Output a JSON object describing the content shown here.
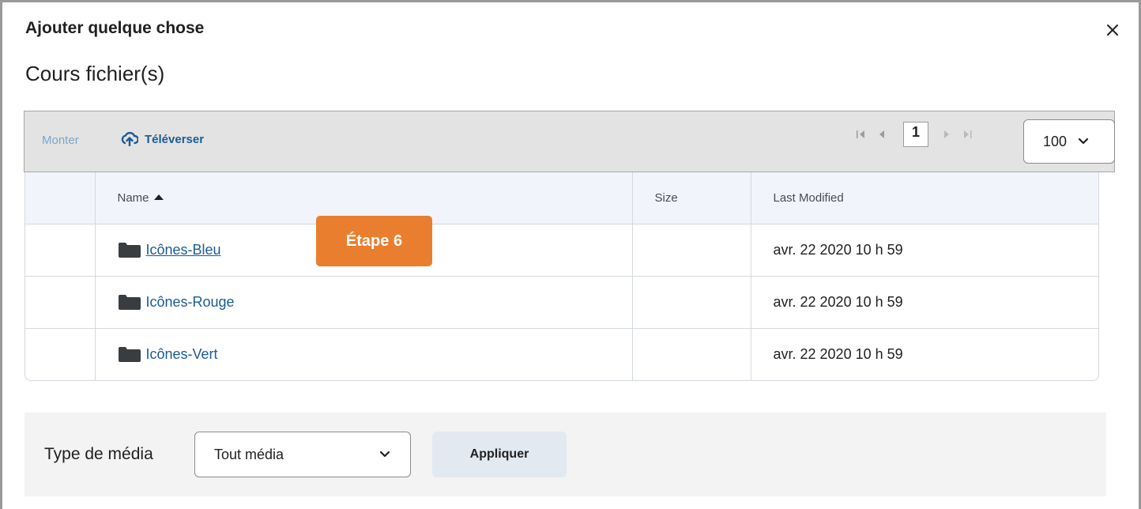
{
  "dialog": {
    "title": "Ajouter quelque chose",
    "subtitle": "Cours fichier(s)",
    "close_icon": "close-icon"
  },
  "toolbar": {
    "monter_label": "Monter",
    "upload_label": "Téléverser",
    "upload_icon": "cloud-upload-icon",
    "pager": {
      "current_page": "1",
      "icons": [
        "first-page-icon",
        "previous-page-icon",
        "next-page-icon",
        "last-page-icon"
      ]
    },
    "per_page": "100"
  },
  "table": {
    "headers": {
      "name": "Name",
      "size": "Size",
      "modified": "Last Modified"
    },
    "sort": "name-ascending",
    "rows": [
      {
        "name": "Icônes-Bleu",
        "size": "",
        "modified": "avr. 22 2020 10 h 59",
        "icon": "folder-icon"
      },
      {
        "name": "Icônes-Rouge",
        "size": "",
        "modified": "avr. 22 2020 10 h 59",
        "icon": "folder-icon"
      },
      {
        "name": "Icônes-Vert",
        "size": "",
        "modified": "avr. 22 2020 10 h 59",
        "icon": "folder-icon"
      }
    ]
  },
  "callout": {
    "label": "Étape 6",
    "color": "#e97f2e"
  },
  "filter": {
    "label": "Type de média",
    "media_type_value": "Tout média",
    "apply_label": "Appliquer"
  },
  "colors": {
    "link": "#1a5c95",
    "monter": "#7aa6c9",
    "toolbar_bg": "#e3e3e3",
    "header_bg": "#f1f5fb",
    "apply_bg": "#e3e9f1"
  }
}
